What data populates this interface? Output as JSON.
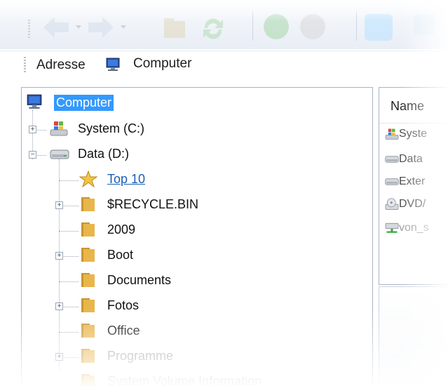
{
  "toolbar": {
    "buttons": [
      "back-icon",
      "forward-icon",
      "up-folder-icon",
      "refresh-icon",
      "go-icon",
      "stop-icon",
      "disk-icon"
    ]
  },
  "address": {
    "label": "Adresse",
    "value": "Computer",
    "icon": "computer-icon"
  },
  "tree": {
    "root": "Computer",
    "items": [
      {
        "label": "System (C:)",
        "icon": "windows-drive-icon",
        "expander": "+"
      },
      {
        "label": "Data (D:)",
        "icon": "drive-icon",
        "expander": "−"
      },
      {
        "label": "Top 10",
        "icon": "star-icon"
      },
      {
        "label": "$RECYCLE.BIN",
        "icon": "folder-icon",
        "expander": "+"
      },
      {
        "label": "2009",
        "icon": "folder-icon"
      },
      {
        "label": "Boot",
        "icon": "folder-icon",
        "expander": "+"
      },
      {
        "label": "Documents",
        "icon": "folder-icon"
      },
      {
        "label": "Fotos",
        "icon": "folder-icon",
        "expander": "+"
      },
      {
        "label": "Office",
        "icon": "folder-icon"
      },
      {
        "label": "Programme",
        "icon": "folder-icon",
        "expander": "+"
      },
      {
        "label": "System Volume Information",
        "icon": "folder-icon"
      }
    ]
  },
  "list": {
    "header": "Name",
    "rows": [
      {
        "label": "Syste",
        "icon": "windows-drive-icon"
      },
      {
        "label": "Data",
        "icon": "drive-icon"
      },
      {
        "label": "Exter",
        "icon": "drive-icon"
      },
      {
        "label": "DVD/",
        "icon": "dvd-icon"
      },
      {
        "label": "von_s",
        "icon": "network-drive-icon"
      }
    ]
  },
  "colors": {
    "selection": "#3399ff",
    "link": "#1a5fb4",
    "folder": "#e8b64a",
    "star": "#f4c542"
  }
}
